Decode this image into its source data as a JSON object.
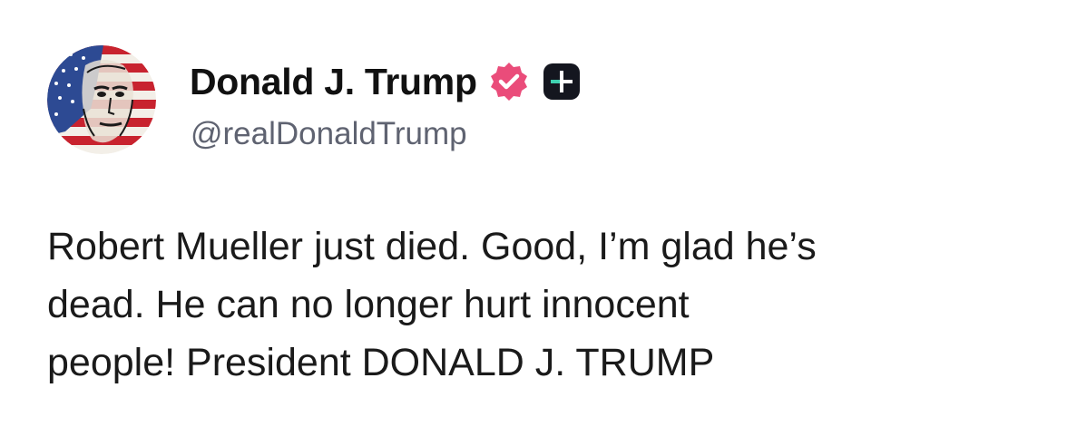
{
  "author": {
    "display_name": "Donald J. Trump",
    "handle": "@realDonaldTrump",
    "avatar_icon": "flag-portrait-avatar",
    "verified_icon": "verified-badge-icon",
    "badge_icon": "plus-badge-icon"
  },
  "post": {
    "lines": [
      "Robert Mueller just died. Good, I’m glad he’s",
      "dead. He can no longer hurt innocent",
      "people! President DONALD J. TRUMP"
    ]
  },
  "colors": {
    "verified": "#ea4c7a",
    "badge_bg": "#14161f",
    "badge_accent": "#3fd0b0",
    "handle_text": "#5f6371"
  }
}
